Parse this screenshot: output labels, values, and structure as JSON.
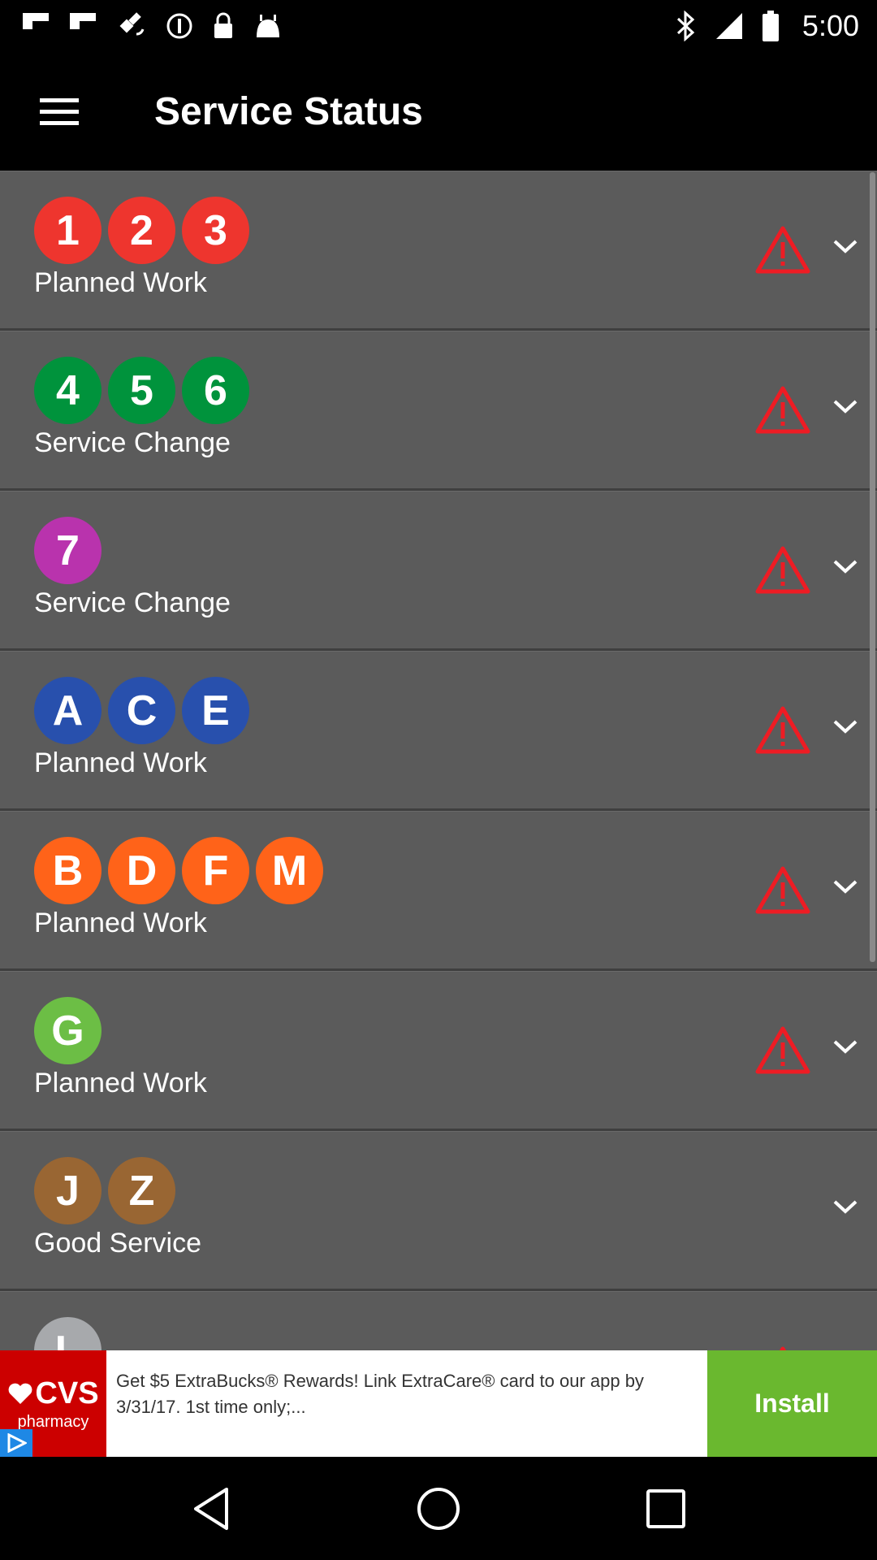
{
  "status_bar": {
    "time": "5:00",
    "icons": [
      "flipboard-icon",
      "flipboard-icon",
      "fake-gps-icon",
      "info-icon",
      "lock-icon",
      "android-icon",
      "bluetooth-icon",
      "signal-icon",
      "battery-icon"
    ]
  },
  "app_bar": {
    "title": "Service Status",
    "menu_icon": "hamburger-menu-icon"
  },
  "lines": [
    {
      "bullets": [
        {
          "label": "1",
          "color": "#ee352e"
        },
        {
          "label": "2",
          "color": "#ee352e"
        },
        {
          "label": "3",
          "color": "#ee352e"
        }
      ],
      "status": "Planned Work",
      "alert": true
    },
    {
      "bullets": [
        {
          "label": "4",
          "color": "#00933c"
        },
        {
          "label": "5",
          "color": "#00933c"
        },
        {
          "label": "6",
          "color": "#00933c"
        }
      ],
      "status": "Service Change",
      "alert": true
    },
    {
      "bullets": [
        {
          "label": "7",
          "color": "#b933ad"
        }
      ],
      "status": "Service Change",
      "alert": true
    },
    {
      "bullets": [
        {
          "label": "A",
          "color": "#2850ad"
        },
        {
          "label": "C",
          "color": "#2850ad"
        },
        {
          "label": "E",
          "color": "#2850ad"
        }
      ],
      "status": "Planned Work",
      "alert": true
    },
    {
      "bullets": [
        {
          "label": "B",
          "color": "#ff6319"
        },
        {
          "label": "D",
          "color": "#ff6319"
        },
        {
          "label": "F",
          "color": "#ff6319"
        },
        {
          "label": "M",
          "color": "#ff6319"
        }
      ],
      "status": "Planned Work",
      "alert": true
    },
    {
      "bullets": [
        {
          "label": "G",
          "color": "#6cbe45"
        }
      ],
      "status": "Planned Work",
      "alert": true
    },
    {
      "bullets": [
        {
          "label": "J",
          "color": "#996633"
        },
        {
          "label": "Z",
          "color": "#996633"
        }
      ],
      "status": "Good Service",
      "alert": false
    },
    {
      "bullets": [
        {
          "label": "L",
          "color": "#a7a9ac"
        }
      ],
      "status": "",
      "alert": true
    }
  ],
  "colors": {
    "alert": "#ee1c24",
    "background": "#5b5b5b"
  },
  "ad": {
    "logo_main": "CVS",
    "logo_sub": "pharmacy",
    "text": "Get $5 ExtraBucks® Rewards! Link ExtraCare® card to our app by 3/31/17. 1st time only;...",
    "install_label": "Install"
  },
  "nav_bar": {
    "back": "back-icon",
    "home": "home-icon",
    "recents": "recents-icon"
  }
}
